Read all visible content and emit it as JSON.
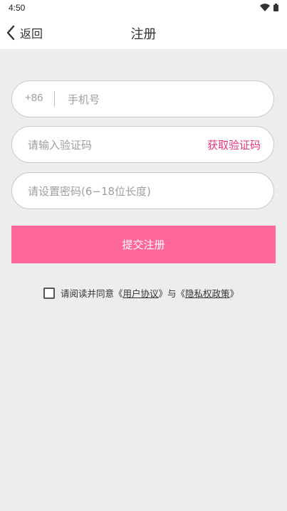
{
  "status_bar": {
    "time": "4:50",
    "icons": [
      "wifi-icon",
      "battery-icon"
    ]
  },
  "header": {
    "back_label": "返回",
    "title": "注册"
  },
  "form": {
    "country_code": "+86",
    "phone_placeholder": "手机号",
    "code_placeholder": "请输入验证码",
    "get_code_label": "获取验证码",
    "password_placeholder": "请设置密码(6−18位长度)",
    "submit_label": "提交注册"
  },
  "agreement": {
    "checked": false,
    "prefix": "请阅读并同意《",
    "user_agreement": "用户协议",
    "middle": "》与《",
    "privacy_policy": "隐私权政策",
    "suffix": "》"
  },
  "colors": {
    "accent": "#ff6699",
    "link_accent": "#e6357a",
    "background": "#ededed"
  }
}
